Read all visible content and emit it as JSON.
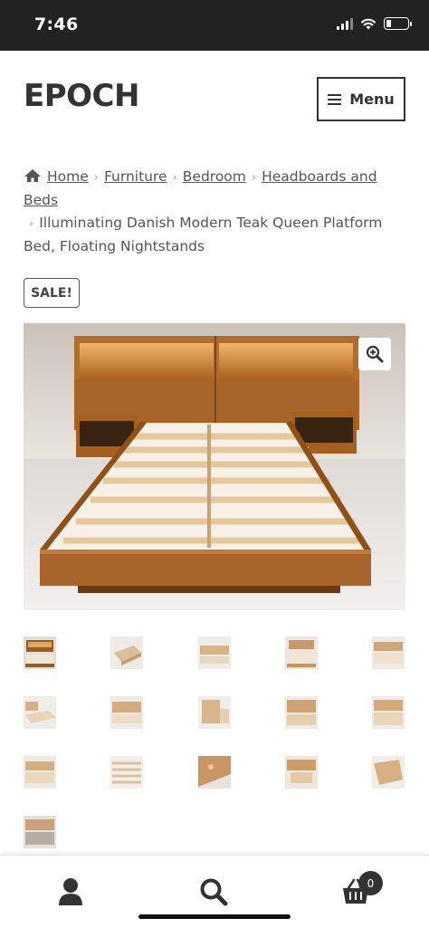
{
  "status_bar": {
    "time": "7:46"
  },
  "header": {
    "site_title": "EPOCH",
    "menu_label": "Menu"
  },
  "breadcrumb": {
    "items": [
      "Home",
      "Furniture",
      "Bedroom",
      "Headboards and Beds"
    ],
    "current": "Illuminating Danish Modern Teak Queen Platform Bed, Floating Nightstands"
  },
  "product": {
    "sale_badge": "SALE!",
    "main_image_alt": "Teak platform bed with lit headboard and floating nightstands",
    "thumbnail_count": 16
  },
  "bottom_nav": {
    "cart_count": "0",
    "icons": [
      "user-icon",
      "search-icon",
      "basket-icon"
    ]
  },
  "colors": {
    "status_bar": "#222222",
    "text": "#333333",
    "teak": "#b5763a"
  }
}
